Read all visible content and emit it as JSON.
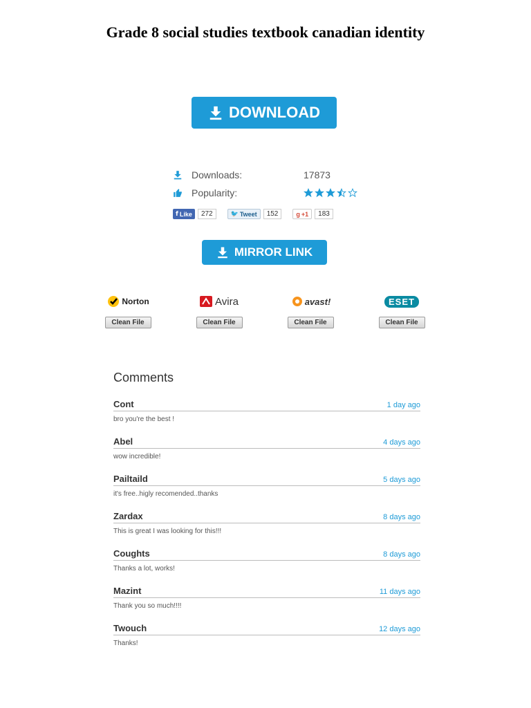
{
  "page": {
    "title": "Grade 8 social studies textbook canadian identity"
  },
  "download_button": {
    "label": "DOWNLOAD"
  },
  "stats": {
    "downloads_label": "Downloads:",
    "downloads_value": "17873",
    "popularity_label": "Popularity:",
    "popularity_rating": 3.5,
    "popularity_max": 5
  },
  "social": {
    "facebook": {
      "label": "Like",
      "count": "272"
    },
    "twitter": {
      "label": "Tweet",
      "count": "152"
    },
    "gplus": {
      "label": "+1",
      "count": "183"
    }
  },
  "mirror_button": {
    "label": "MIRROR LINK"
  },
  "antivirus": [
    {
      "name": "Norton",
      "status": "Clean File"
    },
    {
      "name": "Avira",
      "status": "Clean File"
    },
    {
      "name": "avast!",
      "status": "Clean File"
    },
    {
      "name": "ESET",
      "status": "Clean File"
    }
  ],
  "comments": {
    "heading": "Comments",
    "items": [
      {
        "author": "Cont",
        "time": "1 day ago",
        "text": "bro you're the best !"
      },
      {
        "author": "Abel",
        "time": "4 days ago",
        "text": "wow incredible!"
      },
      {
        "author": "Pailtaild",
        "time": "5 days ago",
        "text": "it's free..higly recomended..thanks"
      },
      {
        "author": "Zardax",
        "time": "8 days ago",
        "text": "This is great I was looking for this!!!"
      },
      {
        "author": "Coughts",
        "time": "8 days ago",
        "text": "Thanks a lot, works!"
      },
      {
        "author": "Mazint",
        "time": "11 days ago",
        "text": "Thank you so much!!!!"
      },
      {
        "author": "Twouch",
        "time": "12 days ago",
        "text": "Thanks!"
      }
    ]
  },
  "colors": {
    "accent": "#1e9bd7",
    "facebook": "#4267b2",
    "avira": "#d71920",
    "avast": "#f7941d",
    "eset": "#0a8ba2",
    "norton": "#ffc20e"
  }
}
